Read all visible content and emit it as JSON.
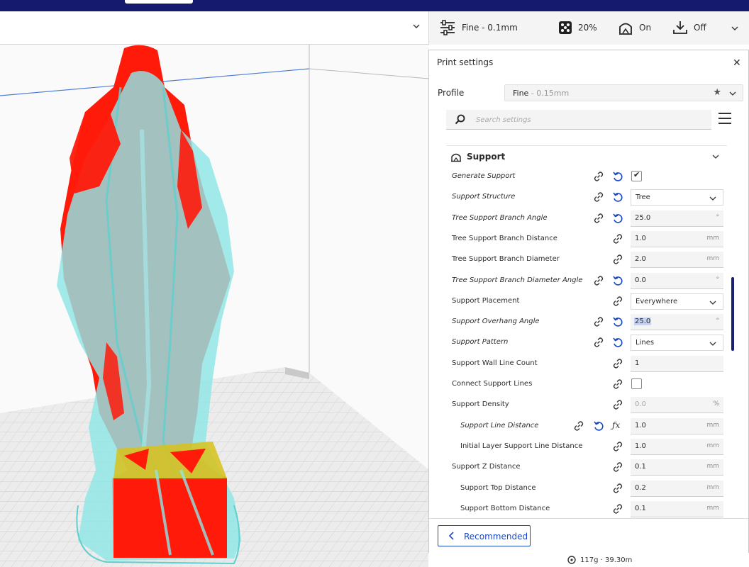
{
  "header": {
    "quality": "Fine - 0.1mm",
    "infill": "20%",
    "support": "On",
    "adhesion": "Off"
  },
  "panel": {
    "title": "Print settings",
    "close": "✕",
    "profile_label": "Profile",
    "profile_name": "Fine",
    "profile_sub": " - 0.15mm",
    "search_placeholder": "Search settings"
  },
  "category": {
    "label": "Support"
  },
  "settings": [
    {
      "label": "Generate Support",
      "italic": true,
      "type": "check",
      "checked": true,
      "reset": true
    },
    {
      "label": "Support Structure",
      "italic": true,
      "type": "dropdown",
      "value": "Tree",
      "reset": true
    },
    {
      "label": "Tree Support Branch Angle",
      "italic": true,
      "type": "field",
      "value": "25.0",
      "unit": "°",
      "reset": true
    },
    {
      "label": "Tree Support Branch Distance",
      "italic": false,
      "type": "field",
      "value": "1.0",
      "unit": "mm"
    },
    {
      "label": "Tree Support Branch Diameter",
      "italic": false,
      "type": "field",
      "value": "2.0",
      "unit": "mm"
    },
    {
      "label": "Tree Support Branch Diameter Angle",
      "italic": true,
      "type": "field",
      "value": "0.0",
      "unit": "°",
      "reset": true
    },
    {
      "label": "Support Placement",
      "italic": false,
      "type": "dropdown",
      "value": "Everywhere"
    },
    {
      "label": "Support Overhang Angle",
      "italic": true,
      "type": "field",
      "value": "25.0",
      "unit": "°",
      "reset": true,
      "selected": true
    },
    {
      "label": "Support Pattern",
      "italic": true,
      "type": "dropdown",
      "value": "Lines",
      "reset": true
    },
    {
      "label": "Support Wall Line Count",
      "italic": false,
      "type": "field",
      "value": "1",
      "unit": ""
    },
    {
      "label": "Connect Support Lines",
      "italic": false,
      "type": "check",
      "checked": false
    },
    {
      "label": "Support Density",
      "italic": false,
      "type": "field",
      "value": "0.0",
      "unit": "%",
      "disabled": true
    },
    {
      "label": "Support Line Distance",
      "italic": true,
      "type": "field",
      "value": "1.0",
      "unit": "mm",
      "reset": true,
      "fx": true,
      "indent": true
    },
    {
      "label": "Initial Layer Support Line Distance",
      "italic": false,
      "type": "field",
      "value": "1.0",
      "unit": "mm",
      "indent": true
    },
    {
      "label": "Support Z Distance",
      "italic": false,
      "type": "field",
      "value": "0.1",
      "unit": "mm"
    },
    {
      "label": "Support Top Distance",
      "italic": false,
      "type": "field",
      "value": "0.2",
      "unit": "mm",
      "indent": true
    },
    {
      "label": "Support Bottom Distance",
      "italic": false,
      "type": "field",
      "value": "0.1",
      "unit": "mm",
      "indent": true
    }
  ],
  "footer": {
    "recommended": "Recommended"
  },
  "status": {
    "estimate": "117g · 39.30m"
  },
  "colors": {
    "accent": "#1a48c4",
    "topbar": "#151a6e",
    "model_overhang": "#ff1a0a",
    "support": "#8fe6e6"
  }
}
